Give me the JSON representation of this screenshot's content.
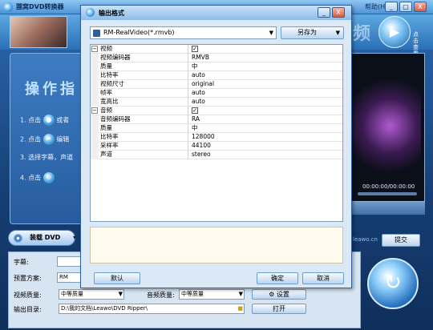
{
  "app": {
    "title": "狸窝DVD转换器",
    "help_menu": "帮助(H)",
    "window_buttons": [
      "_",
      "▢",
      "X"
    ],
    "banner_text": "频",
    "play_side_text": "点击查看",
    "guide_title": "操作指",
    "steps": [
      {
        "num": "1. 点击",
        "suffix": "或者"
      },
      {
        "num": "2. 点击",
        "suffix": "编辑"
      },
      {
        "num": "3. 选择字幕，声道",
        "suffix": ""
      },
      {
        "num": "4. 点击",
        "suffix": ""
      }
    ],
    "time_text": "00:00:00/00:00:00",
    "load_button": "装载 DVD",
    "site_text": "leawo.cn",
    "submit_button": "提交",
    "bottom": {
      "subtitle_label": "字幕:",
      "preset_label": "预置方案:",
      "preset_value": "RM",
      "video_quality_label": "视频质量:",
      "video_quality_value": "中等质量",
      "audio_quality_label": "音频质量:",
      "audio_quality_value": "中等质量",
      "settings_button": "设置",
      "output_label": "输出目录:",
      "output_path": "D:\\我的文档\\Leawo\\DVD Ripper\\",
      "open_button": "打开"
    }
  },
  "dialog": {
    "title": "输出格式",
    "buttons": [
      "_",
      "X"
    ],
    "format_value": "RM-RealVideo(*.rmvb)",
    "save_as_button": "另存为",
    "video_section": {
      "name": "视频",
      "checked": "✓",
      "props": [
        {
          "name": "视频编码器",
          "value": "RMVB"
        },
        {
          "name": "质量",
          "value": "中"
        },
        {
          "name": "比特率",
          "value": "auto"
        },
        {
          "name": "视频尺寸",
          "value": "original"
        },
        {
          "name": "帧率",
          "value": "auto"
        },
        {
          "name": "宽高比",
          "value": "auto"
        }
      ]
    },
    "audio_section": {
      "name": "音频",
      "checked": "✓",
      "props": [
        {
          "name": "音频编码器",
          "value": "RA"
        },
        {
          "name": "质量",
          "value": "中"
        },
        {
          "name": "比特率",
          "value": "128000"
        },
        {
          "name": "采样率",
          "value": "44100"
        },
        {
          "name": "声道",
          "value": "stereo"
        }
      ]
    },
    "default_button": "默认",
    "ok_button": "确定",
    "cancel_button": "取消"
  }
}
